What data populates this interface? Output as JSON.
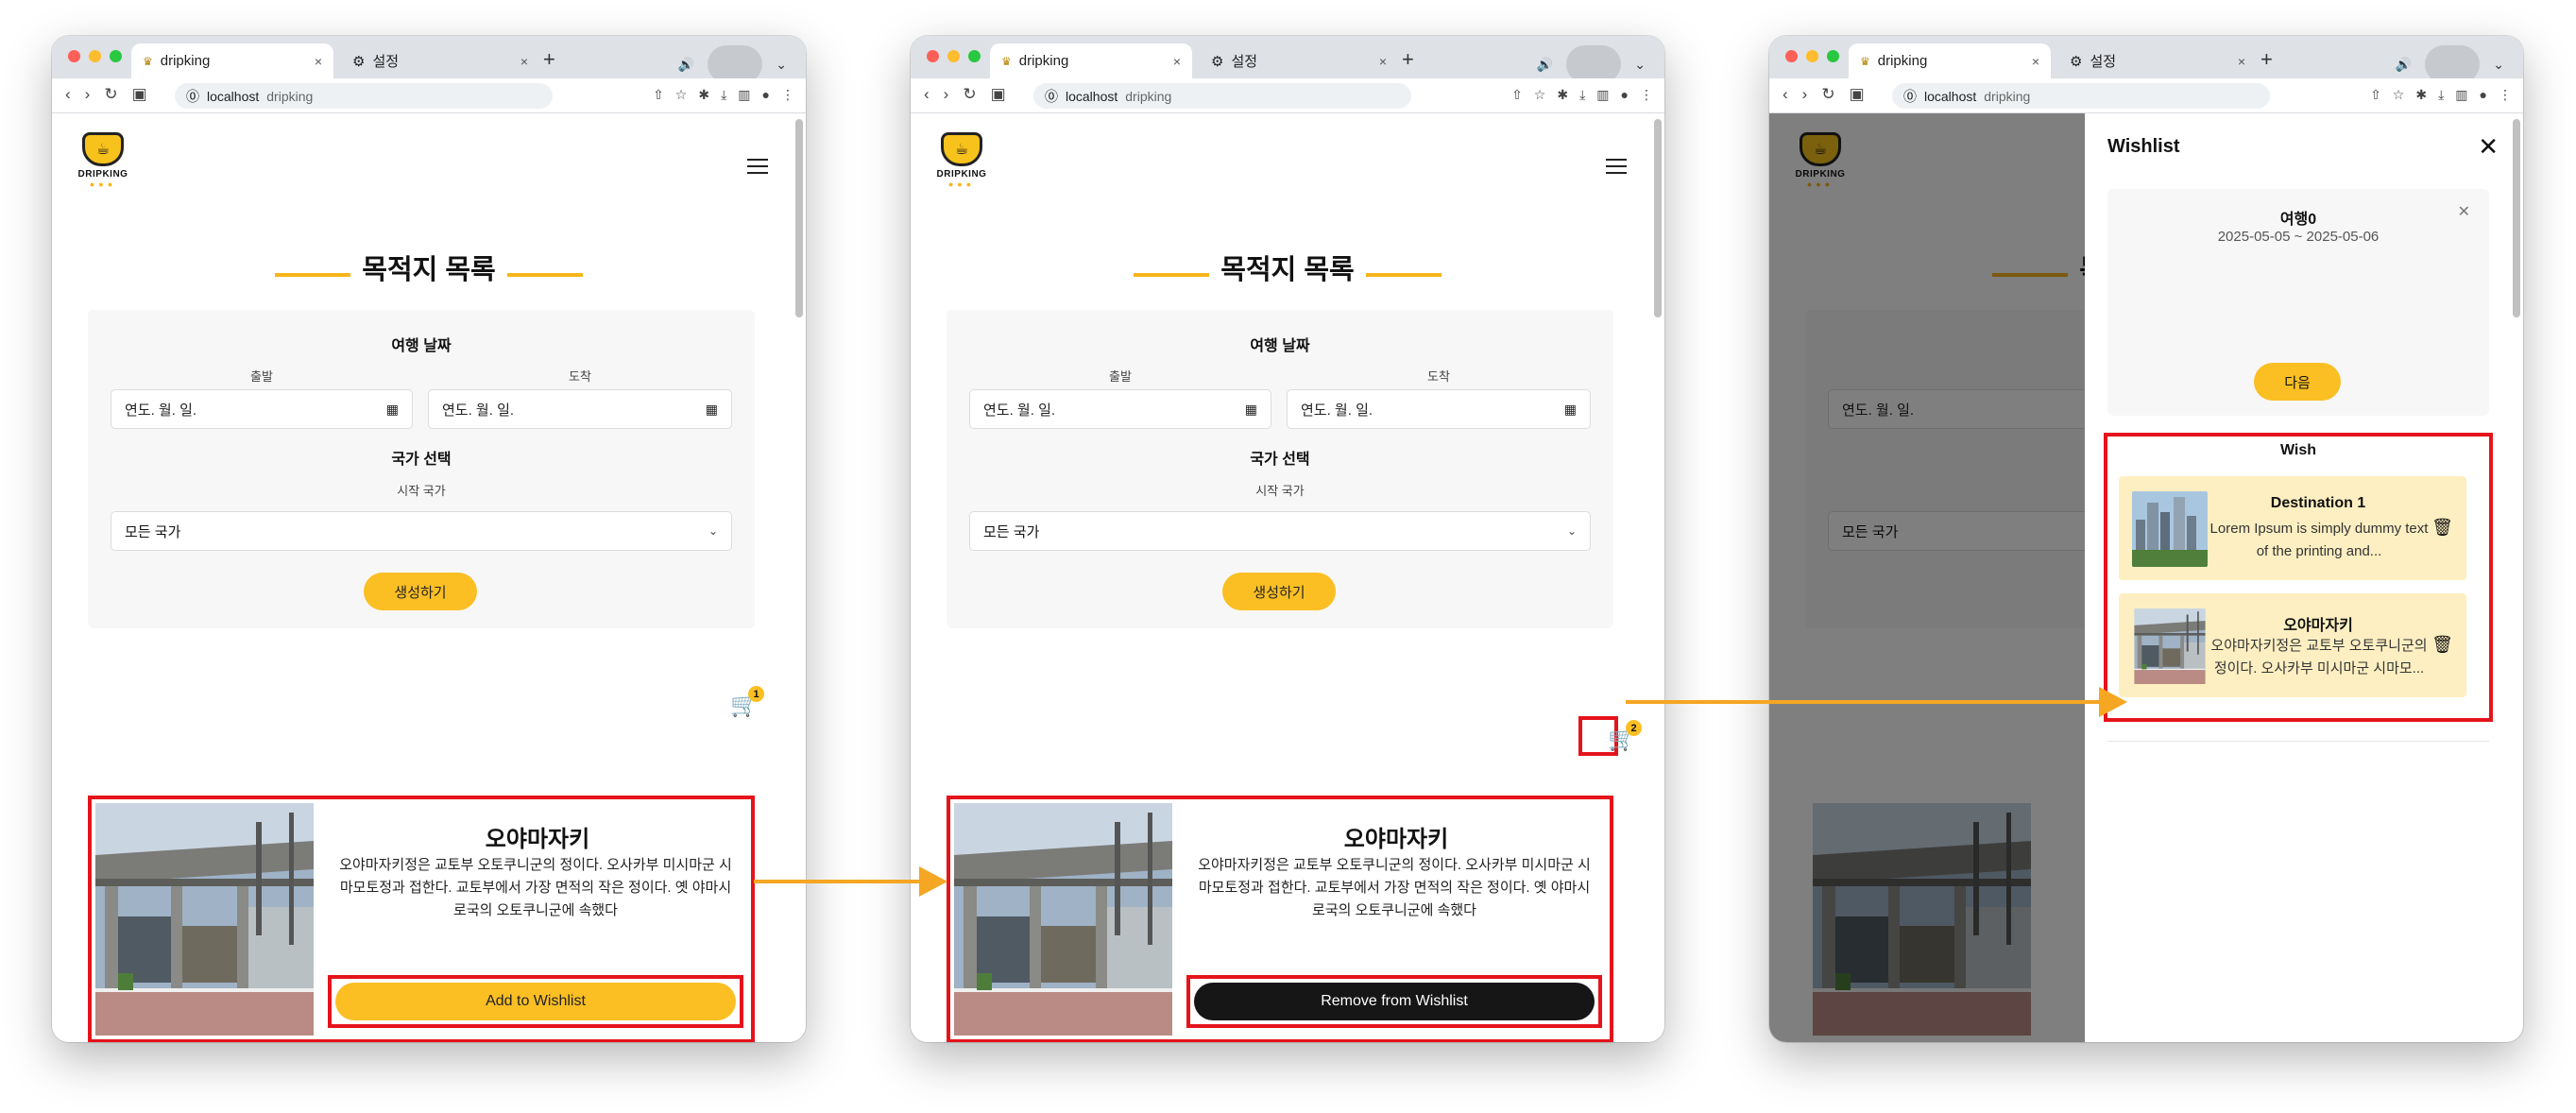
{
  "browser": {
    "tab_active_title": "dripking",
    "tab_second_title": "설정",
    "new_tab_glyph": "+",
    "url_host": "localhost",
    "url_path": "dripking",
    "tab_close_glyph": "×"
  },
  "page": {
    "logo_text": "DRIPKING",
    "section_title": "목적지 목록",
    "form": {
      "date_heading": "여행 날짜",
      "depart_label": "출발",
      "arrive_label": "도착",
      "date_placeholder": "연도. 월. 일.",
      "country_heading": "국가 선택",
      "start_country_label": "시작 국가",
      "country_selected": "모든 국가",
      "generate_label": "생성하기"
    },
    "destination": {
      "name": "오야마자키",
      "description": "오야마자키정은 교토부 오토쿠니군의 정이다. 오사카부 미시마군 시마모토정과 접한다. 교토부에서 가장 면적의 작은 정이다. 옛 야마시로국의 오토쿠니군에 속했다",
      "add_label": "Add to Wishlist",
      "remove_label": "Remove from Wishlist"
    }
  },
  "screens": [
    {
      "cart_count": "1",
      "wish_button_state": "add"
    },
    {
      "cart_count": "2",
      "wish_button_state": "remove"
    },
    {
      "drawer_open": true
    }
  ],
  "drawer": {
    "title": "Wishlist",
    "trip": {
      "name": "여행0",
      "dates": "2025-05-05 ~ 2025-05-06"
    },
    "next_label": "다음",
    "wish_heading": "Wish",
    "items": [
      {
        "name": "Destination 1",
        "description": "Lorem Ipsum is simply dummy text of the printing and..."
      },
      {
        "name": "오야마자키",
        "description": "오야마자키정은 교토부 오토쿠니군의 정이다. 오사카부 미시마군 시마모..."
      }
    ]
  },
  "colors": {
    "accent": "#fbbf24",
    "highlight_frame": "#e5131b",
    "arrow": "#f5a623",
    "remove_button": "#161616"
  },
  "icons": [
    "hamburger-menu-icon",
    "cart-icon",
    "calendar-icon",
    "chevron-down-icon",
    "close-icon",
    "trash-icon",
    "settings-gear-icon"
  ]
}
